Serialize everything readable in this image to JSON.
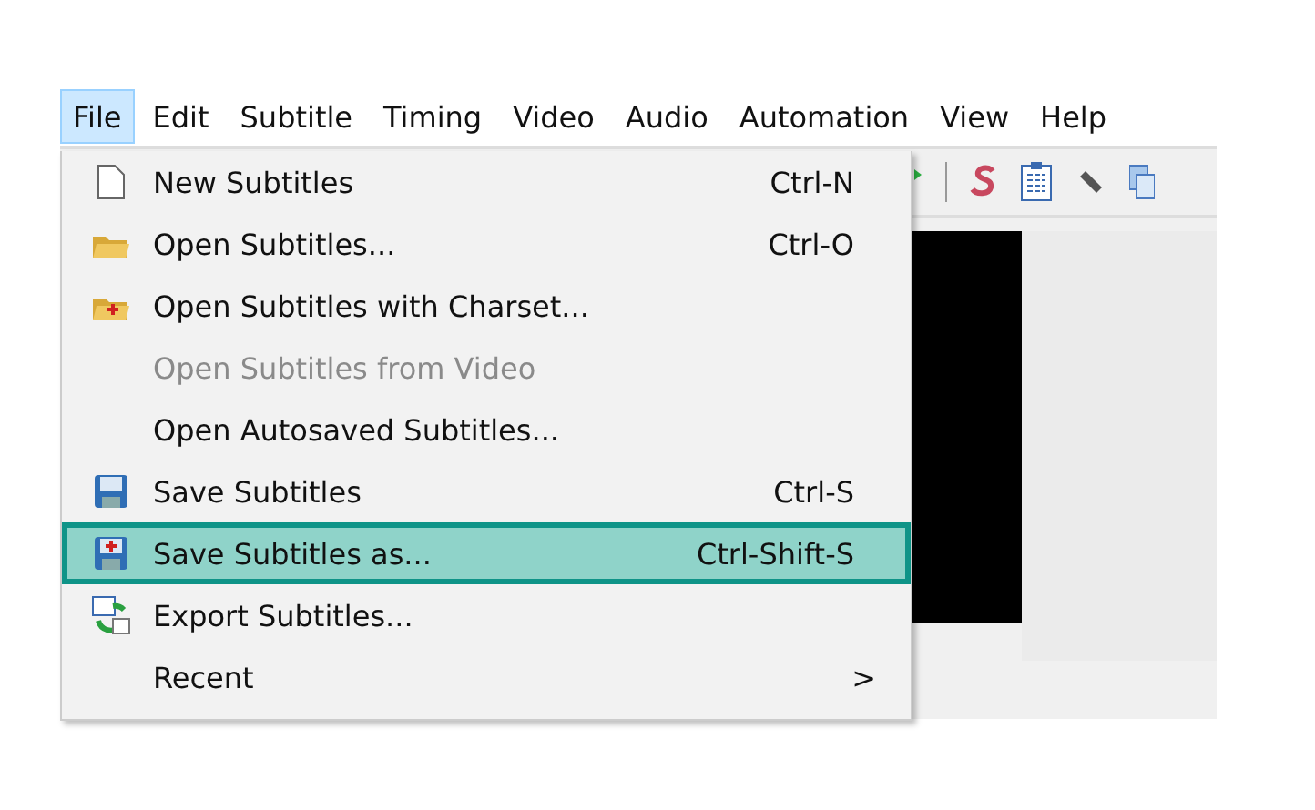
{
  "menubar": [
    {
      "label": "File",
      "selected": true
    },
    {
      "label": "Edit",
      "selected": false
    },
    {
      "label": "Subtitle",
      "selected": false
    },
    {
      "label": "Timing",
      "selected": false
    },
    {
      "label": "Video",
      "selected": false
    },
    {
      "label": "Audio",
      "selected": false
    },
    {
      "label": "Automation",
      "selected": false
    },
    {
      "label": "View",
      "selected": false
    },
    {
      "label": "Help",
      "selected": false
    }
  ],
  "file_menu": [
    {
      "label": "New Subtitles",
      "shortcut": "Ctrl-N",
      "disabled": false,
      "selected": false
    },
    {
      "label": "Open Subtitles...",
      "shortcut": "Ctrl-O",
      "disabled": false,
      "selected": false
    },
    {
      "label": "Open Subtitles with Charset...",
      "disabled": false,
      "selected": false
    },
    {
      "label": "Open Subtitles from Video",
      "disabled": true,
      "selected": false
    },
    {
      "label": "Open Autosaved Subtitles...",
      "disabled": false,
      "selected": false
    },
    {
      "label": "Save Subtitles",
      "shortcut": "Ctrl-S",
      "disabled": false,
      "selected": false
    },
    {
      "label": "Save Subtitles as...",
      "shortcut": "Ctrl-Shift-S",
      "disabled": false,
      "selected": true
    },
    {
      "label": "Export Subtitles...",
      "disabled": false,
      "selected": false
    },
    {
      "label": "Recent",
      "submenu_arrow": ">",
      "disabled": false,
      "selected": false
    }
  ]
}
